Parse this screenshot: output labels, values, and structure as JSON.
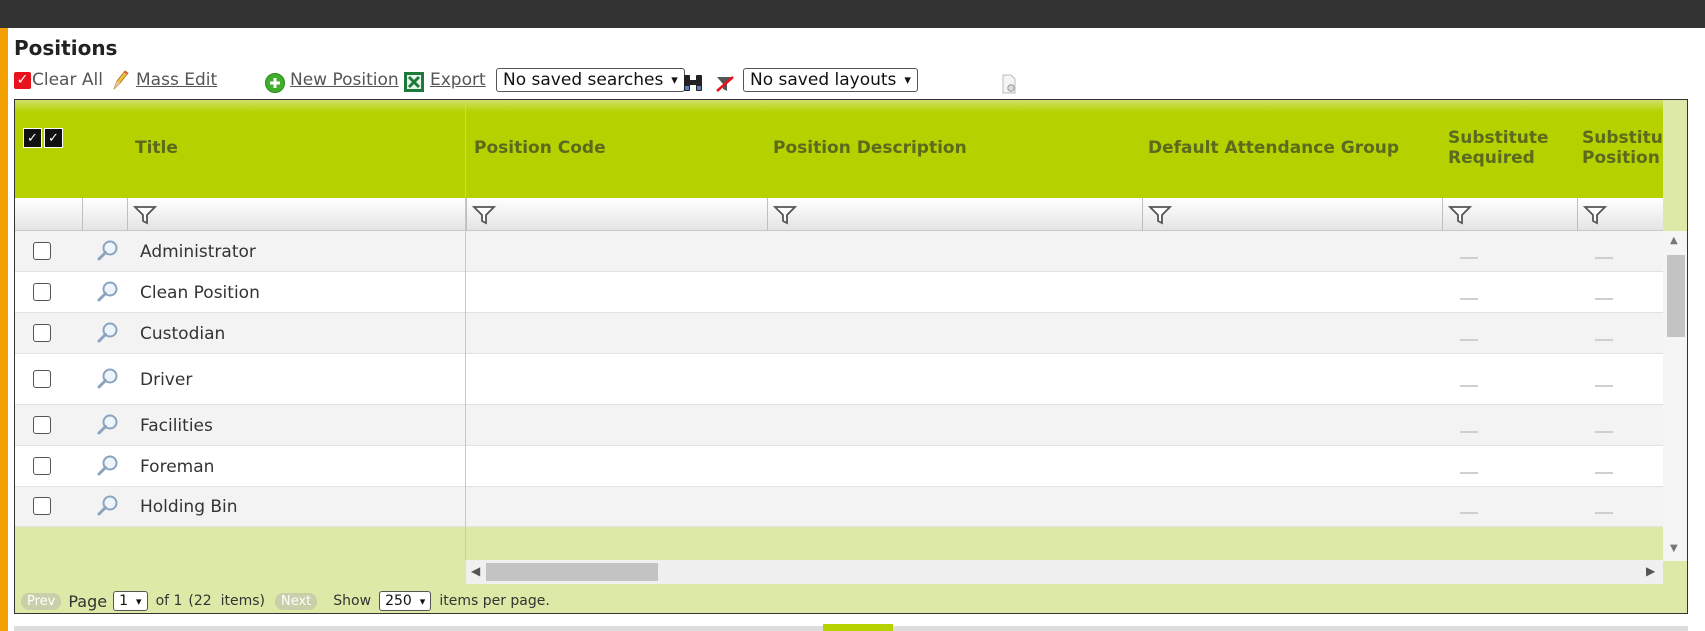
{
  "page": {
    "title": "Positions"
  },
  "toolbar": {
    "clear_all": "Clear All",
    "mass_edit": "Mass Edit",
    "new_position": "New Position",
    "export": "Export",
    "saved_searches": "No saved searches",
    "saved_layouts": "No saved layouts"
  },
  "grid": {
    "columns": {
      "title": "Title",
      "position_code": "Position Code",
      "position_description": "Position Description",
      "default_attendance_group": "Default Attendance Group",
      "substitute_required_1": "Substitute",
      "substitute_required_2": "Required",
      "substitute_position_1": "Substitu",
      "substitute_position_2": "Position"
    },
    "rows": [
      {
        "title": "Administrator"
      },
      {
        "title": "Clean Position"
      },
      {
        "title": "Custodian"
      },
      {
        "title": "Driver"
      },
      {
        "title": "Facilities"
      },
      {
        "title": "Foreman"
      },
      {
        "title": "Holding Bin"
      }
    ]
  },
  "pager": {
    "prev": "Prev",
    "page_label": "Page",
    "page_value": "1",
    "of_text": "of 1",
    "items_text": "(22  items)",
    "next": "Next",
    "show_label": "Show",
    "per_page_value": "250",
    "per_page_suffix": "items per page."
  },
  "colors": {
    "header_green": "#b5d200",
    "pager_bg": "#dde9a6",
    "top_bar": "#333333",
    "left_stripe": "#f2a000",
    "check_red": "#e8111c"
  }
}
